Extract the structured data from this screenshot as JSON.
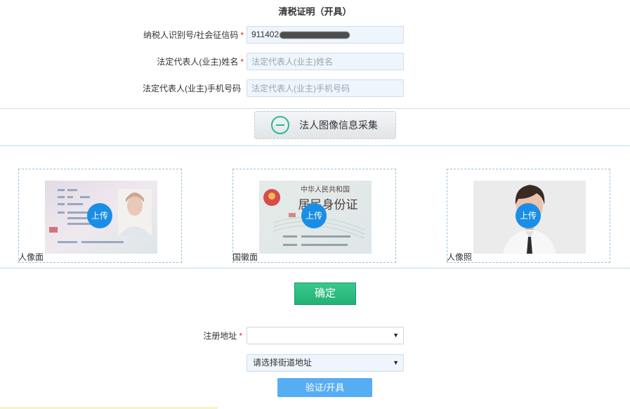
{
  "page": {
    "title": "清税证明（开具）"
  },
  "form": {
    "tax_id": {
      "label": "纳税人识别号/社会征信码",
      "value": "911402",
      "required": true
    },
    "legal_name": {
      "label": "法定代表人(业主)姓名",
      "placeholder": "法定代表人(业主)姓名",
      "required": true
    },
    "legal_phone": {
      "label": "法定代表人(业主)手机号码",
      "placeholder": "法定代表人(业主)手机号码",
      "required": false
    }
  },
  "collect": {
    "label": "法人图像信息采集",
    "icon": "minus-circle-icon"
  },
  "uploads": [
    {
      "caption": "人像面",
      "badge": "上传"
    },
    {
      "caption": "国徽面",
      "badge": "上传",
      "seal_text_top": "中华人民共和国",
      "seal_text_main": "居民身份证"
    },
    {
      "caption": "人像照",
      "badge": "上传"
    }
  ],
  "confirm": {
    "label": "确定"
  },
  "address": {
    "label": "注册地址",
    "required": true,
    "district_value": "",
    "street_value": "请选择街道地址"
  },
  "verify": {
    "label": "验证/开具"
  },
  "colors": {
    "accent_green": "#2db796",
    "upload_blue": "#1a8ee6",
    "verify_blue": "#57adf3",
    "required_red": "#e22222"
  }
}
